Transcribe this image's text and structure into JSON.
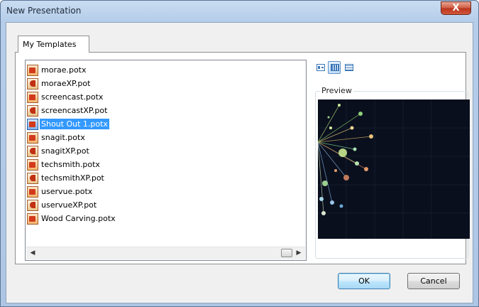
{
  "window": {
    "title": "New Presentation",
    "close_label": "X"
  },
  "tabs": [
    {
      "label": "My Templates"
    }
  ],
  "templates": [
    {
      "name": "morae.potx",
      "icon": "pptx-template-icon",
      "selected": false
    },
    {
      "name": "moraeXP.pot",
      "icon": "pot-template-icon",
      "selected": false
    },
    {
      "name": "screencast.potx",
      "icon": "pptx-template-icon",
      "selected": false
    },
    {
      "name": "screencastXP.pot",
      "icon": "pot-template-icon",
      "selected": false
    },
    {
      "name": "Shout Out 1.potx",
      "icon": "pptx-template-icon",
      "selected": true
    },
    {
      "name": "snagit.potx",
      "icon": "pptx-template-icon",
      "selected": false
    },
    {
      "name": "snagitXP.pot",
      "icon": "pot-template-icon",
      "selected": false
    },
    {
      "name": "techsmith.potx",
      "icon": "pptx-template-icon",
      "selected": false
    },
    {
      "name": "techsmithXP.pot",
      "icon": "pot-template-icon",
      "selected": false
    },
    {
      "name": "uservue.potx",
      "icon": "pptx-template-icon",
      "selected": false
    },
    {
      "name": "uservueXP.pot",
      "icon": "pot-template-icon",
      "selected": false
    },
    {
      "name": "Wood Carving.potx",
      "icon": "pptx-template-icon",
      "selected": false
    }
  ],
  "view_buttons": [
    {
      "name": "large-icons-view-icon",
      "active": false
    },
    {
      "name": "list-view-icon",
      "active": true
    },
    {
      "name": "details-view-icon",
      "active": false
    }
  ],
  "preview": {
    "label": "Preview"
  },
  "buttons": {
    "ok": "OK",
    "cancel": "Cancel"
  },
  "colors": {
    "selection": "#3399ff",
    "preview_background": "#0a0f1e",
    "title_bar": "#c9dcf1"
  }
}
